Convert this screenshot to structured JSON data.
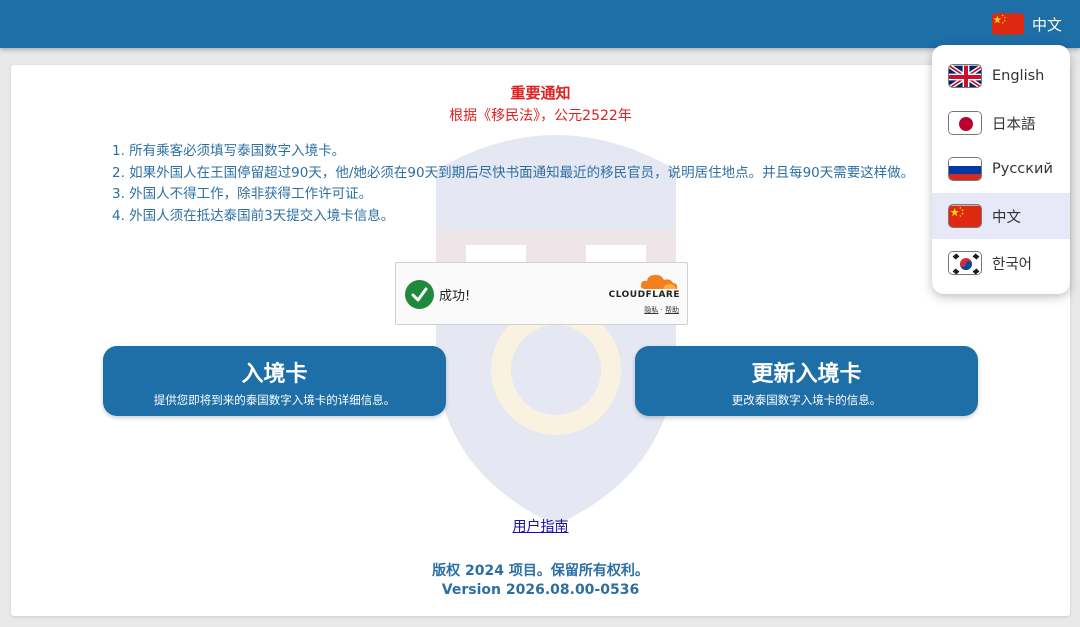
{
  "header": {
    "current_language": "中文",
    "current_flag": "china-flag-icon"
  },
  "notice": {
    "title": "重要通知",
    "subtitle": "根据《移民法》，公元2522年",
    "rules": [
      "1. 所有乘客必须填写泰国数字入境卡。",
      "2. 如果外国人在王国停留超过90天，他/她必须在90天到期后尽快书面通知最近的移民官员，说明居住地点。并且每90天需要这样做。",
      "3. 外国人不得工作，除非获得工作许可证。",
      "4. 外国人须在抵达泰国前3天提交入境卡信息。"
    ]
  },
  "captcha": {
    "status": "成功!",
    "brand": "CLOUDFLARE",
    "privacy": "隐私",
    "separator": "·",
    "help": "帮助",
    "check_icon": "check-circle-icon",
    "brand_color": "#f38020"
  },
  "buttons": {
    "entry": {
      "title": "入境卡",
      "desc": "提供您即将到来的泰国数字入境卡的详细信息。"
    },
    "update": {
      "title": "更新入境卡",
      "desc": "更改泰国数字入境卡的信息。"
    }
  },
  "footer": {
    "guide": "用户指南",
    "copyright": "版权 2024 项目。保留所有权利。",
    "version": "Version 2026.08.00-0536"
  },
  "language_menu": {
    "items": [
      {
        "label": "English",
        "flag": "uk-flag-icon",
        "selected": false
      },
      {
        "label": "日本語",
        "flag": "japan-flag-icon",
        "selected": false
      },
      {
        "label": "Русский",
        "flag": "russia-flag-icon",
        "selected": false
      },
      {
        "label": "中文",
        "flag": "china-flag-icon",
        "selected": true
      },
      {
        "label": "한국어",
        "flag": "korea-flag-icon",
        "selected": false
      }
    ]
  },
  "colors": {
    "primary": "#1e6ea7",
    "notice_red": "#e02020",
    "text_blue": "#2d6fa3",
    "link": "#1a0dab",
    "selected_bg": "#e8e9f8"
  }
}
